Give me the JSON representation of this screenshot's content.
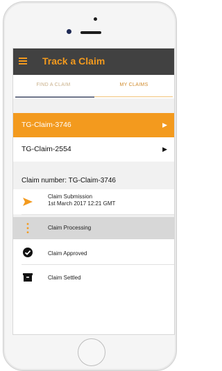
{
  "app": {
    "title": "Track a Claim",
    "accent": "#f39a1e",
    "bar_color": "#414141"
  },
  "tabs": [
    {
      "label": "FIND A CLAIM"
    },
    {
      "label": "MY CLAIMS"
    }
  ],
  "claims": [
    {
      "id": "TG-Claim-3746",
      "selected": true
    },
    {
      "id": "TG-Claim-2554",
      "selected": false
    }
  ],
  "detail": {
    "claim_number": "Claim number: TG-Claim-3746",
    "steps": [
      {
        "title": "Claim Submission",
        "subtitle": "1st March 2017 12:21 GMT",
        "icon": "send-arrow-icon"
      },
      {
        "title": "Claim Processing",
        "icon": "vertical-dots-icon"
      },
      {
        "title": "Claim Approved",
        "icon": "check-circle-icon"
      },
      {
        "title": "Claim Settled",
        "icon": "box-icon"
      }
    ]
  }
}
